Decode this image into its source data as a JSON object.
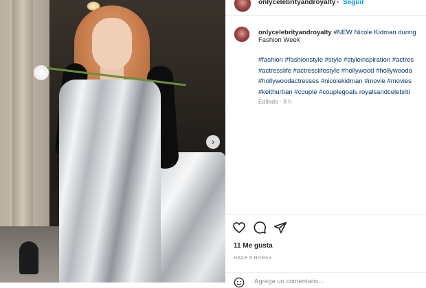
{
  "post": {
    "username": "onlycelebrityandroyalty",
    "follow_separator": "•",
    "follow_label": "Seguir"
  },
  "caption": {
    "username": "onlycelebrityandroyalty",
    "title_line1": "#NEW Nicole Kidman during",
    "title_line2": "Fashion Week",
    "hashtag_lines": [
      "#fashion #fashionstyle #style #styleinspiration #actres",
      "#actresslife #actresslifestyle #hollywood #hollywooda",
      "#hollywoodactresses #nicolekidman #movie #movies",
      "#keithurban #couple #couplegoals royalsandcelebriti"
    ],
    "edited": "Editado · 8 h"
  },
  "actions": {
    "icons": [
      "heart-icon",
      "comment-icon",
      "share-icon"
    ],
    "likes": "11 Me gusta",
    "time_ago": "HACE 8 HORAS"
  },
  "comment_box": {
    "placeholder": "Agrega un comentario..."
  },
  "colors": {
    "link_blue": "#0095f6",
    "hashtag": "#00376b",
    "muted": "#8e8e8e",
    "text": "#262626"
  }
}
